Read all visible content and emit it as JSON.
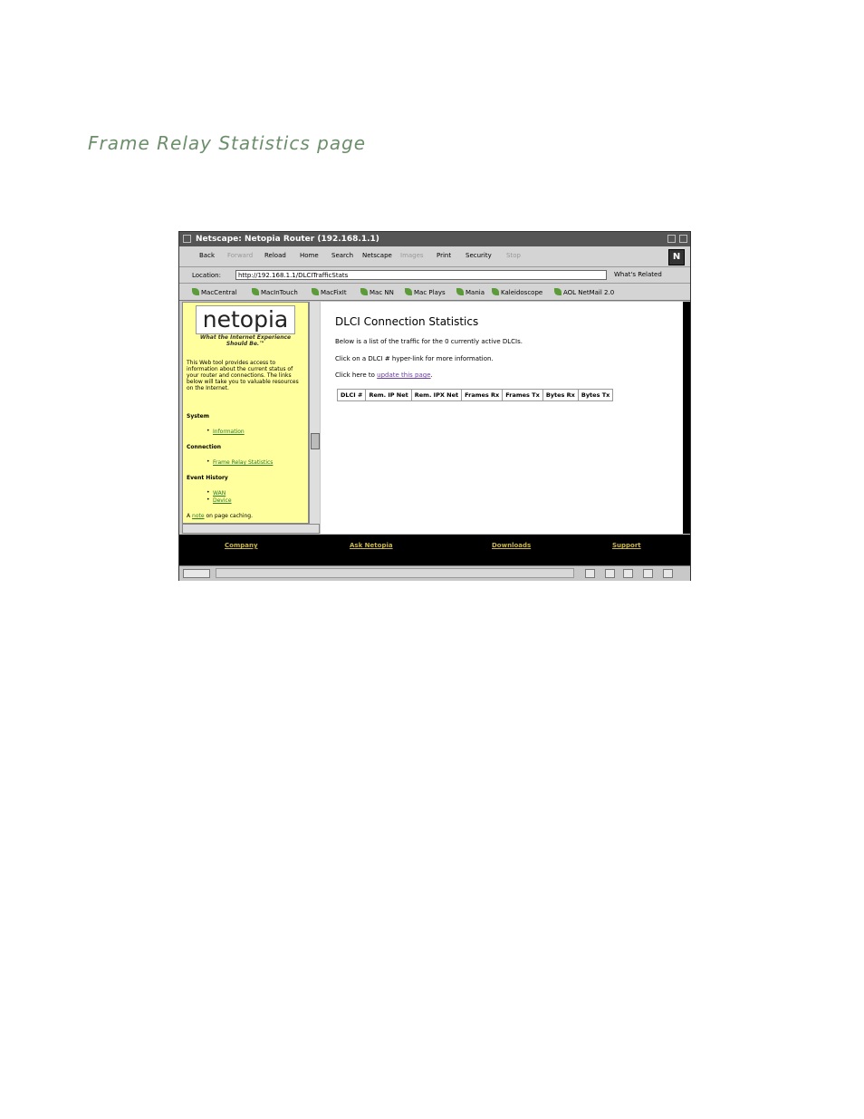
{
  "doc_title": "Frame Relay Statistics page",
  "window": {
    "title": "Netscape: Netopia Router (192.168.1.1)",
    "toolbar": [
      "Back",
      "Forward",
      "Reload",
      "Home",
      "Search",
      "Netscape",
      "Images",
      "Print",
      "Security",
      "Stop"
    ],
    "location_label": "Location:",
    "url": "http://192.168.1.1/DLCITrafficStats",
    "whats_related": "What's Related",
    "bookmarks": [
      "MacCentral",
      "MacInTouch",
      "MacFixIt",
      "Mac NN",
      "Mac Plays",
      "Mania",
      "Kaleidoscope",
      "AOL NetMail 2.0"
    ]
  },
  "sidebar": {
    "logo": "netopia",
    "tagline": "What the Internet Experience Should Be.™",
    "intro": "This Web tool provides access to information about the current status of your router and connections. The links below will take you to valuable resources on the Internet.",
    "system_heading": "System",
    "system_link": "Information",
    "connection_heading": "Connection",
    "connection_link": "Frame Relay Statistics",
    "event_heading": "Event History",
    "event_links": [
      "WAN",
      "Device"
    ],
    "note_prefix": "A",
    "note_link": "note",
    "note_suffix": "on page caching."
  },
  "main": {
    "heading": "DLCI Connection Statistics",
    "line1": "Below is a list of the traffic for the 0 currently active DLCIs.",
    "line2": "Click on a DLCI # hyper-link for more information.",
    "line3_prefix": "Click here to",
    "line3_link": "update this page",
    "line3_suffix": ".",
    "columns": [
      "DLCI #",
      "Rem. IP Net",
      "Rem. IPX Net",
      "Frames Rx",
      "Frames Tx",
      "Bytes Rx",
      "Bytes Tx"
    ]
  },
  "footer": [
    "Company",
    "Ask Netopia",
    "Downloads",
    "Support"
  ]
}
